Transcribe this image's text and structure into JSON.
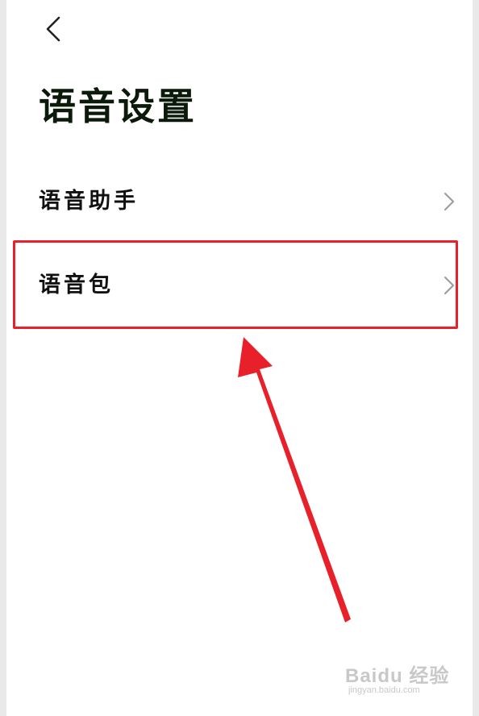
{
  "header": {
    "back_icon": "chevron-left-icon"
  },
  "page": {
    "title": "语音设置"
  },
  "list": {
    "items": [
      {
        "label": "语音助手",
        "icon": "chevron-right-icon"
      },
      {
        "label": "语音包",
        "icon": "chevron-right-icon"
      }
    ]
  },
  "annotation": {
    "color": "#e8202a"
  },
  "watermark": {
    "main": "Baidu 经验",
    "sub": "jingyan.baidu.com"
  }
}
